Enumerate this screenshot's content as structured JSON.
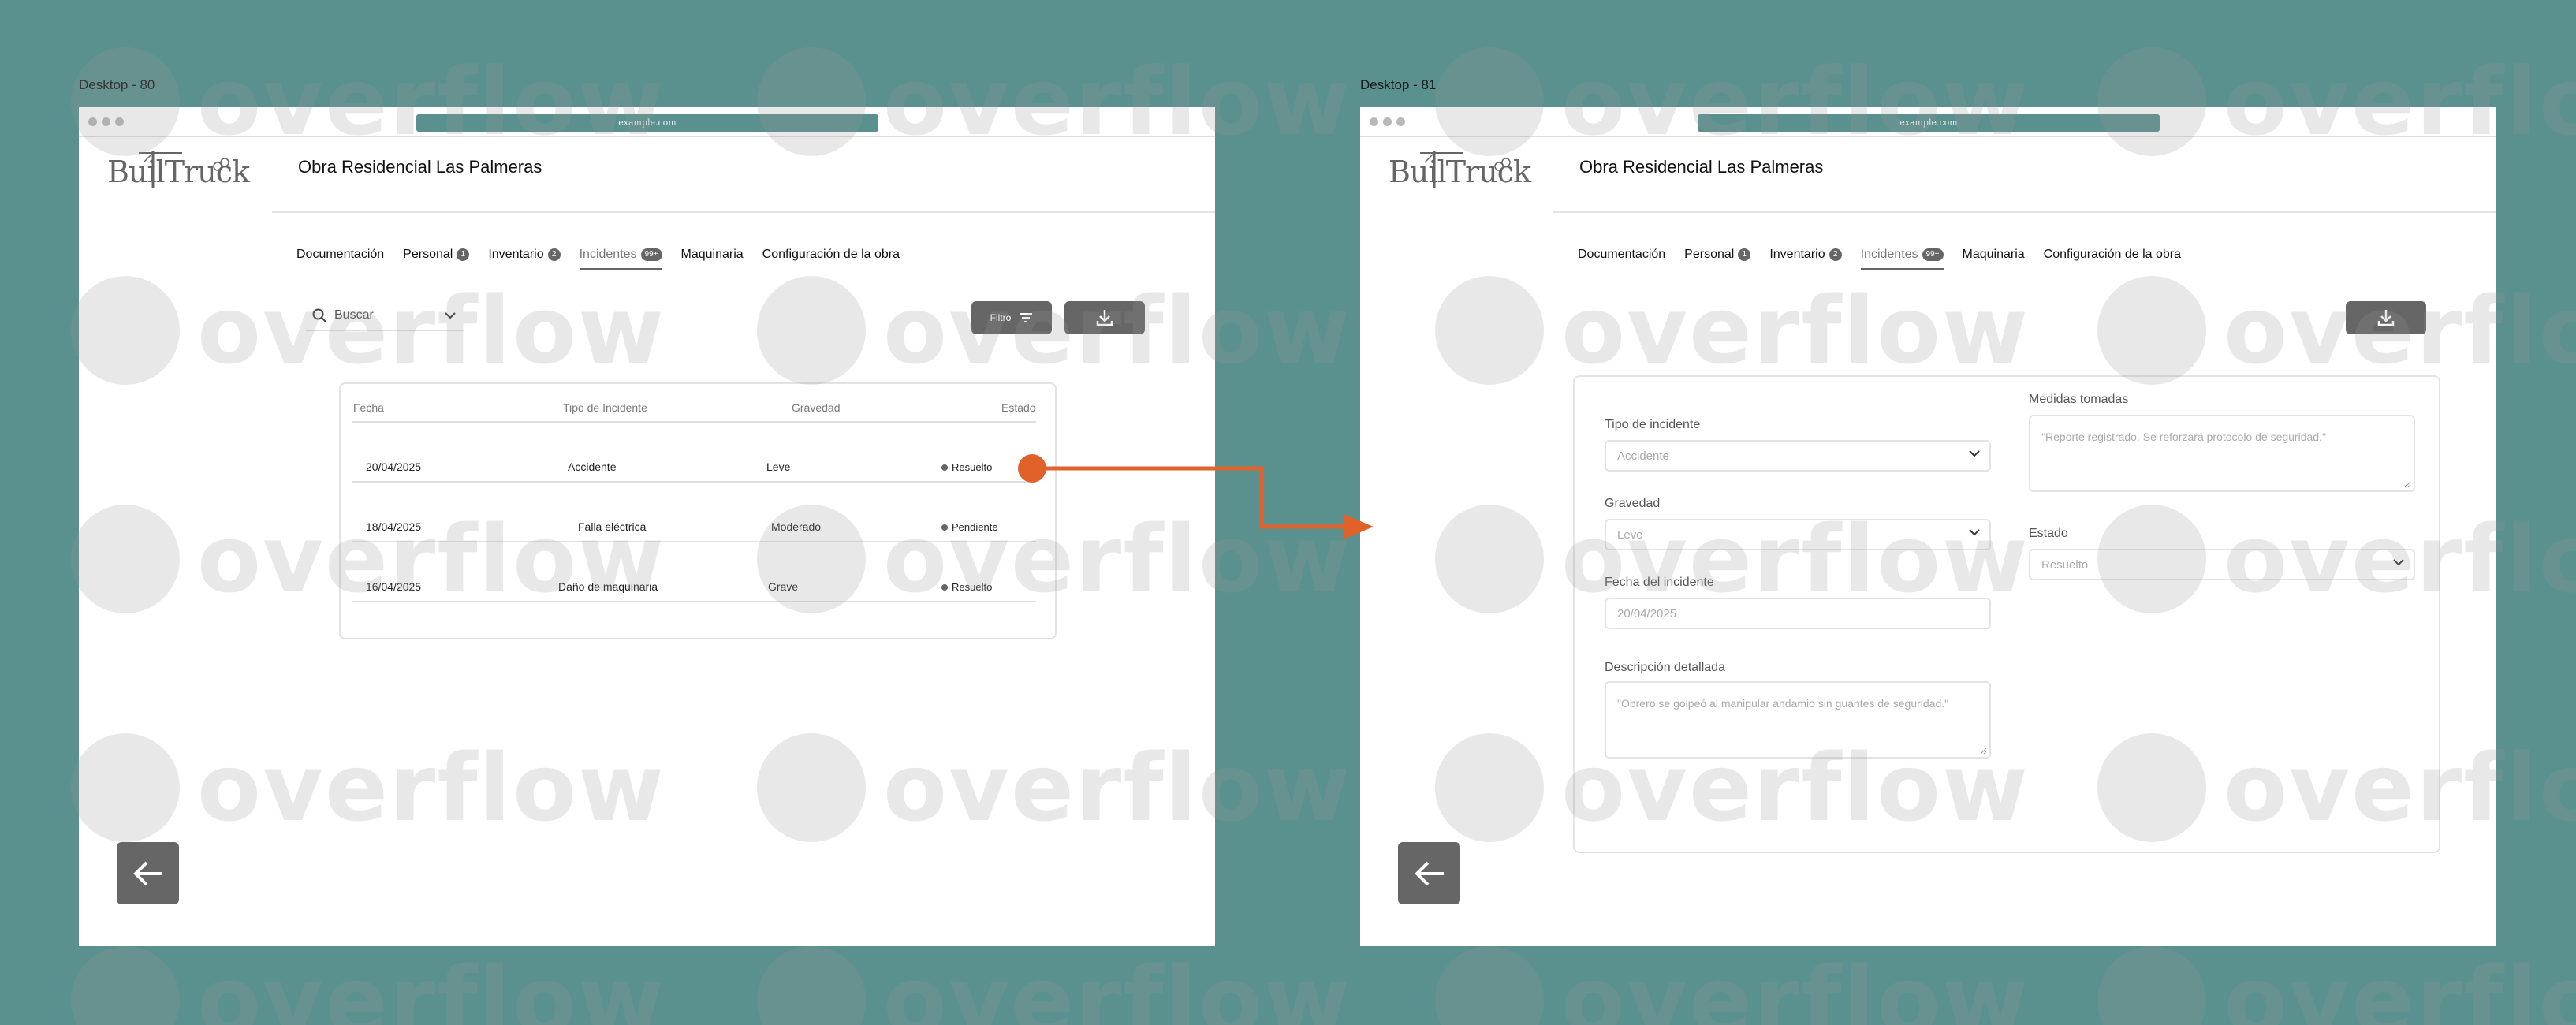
{
  "frames": {
    "left_label": "Desktop - 80",
    "right_label": "Desktop - 81"
  },
  "browser": {
    "url": "example.com"
  },
  "brand": {
    "logo_text": "BuilTruck"
  },
  "project": {
    "title": "Obra Residencial Las Palmeras"
  },
  "tabs": [
    {
      "label": "Documentación",
      "badge": ""
    },
    {
      "label": "Personal",
      "badge": "1"
    },
    {
      "label": "Inventario",
      "badge": "2"
    },
    {
      "label": "Incidentes",
      "badge": "99+"
    },
    {
      "label": "Maquinaria",
      "badge": ""
    },
    {
      "label": "Configuración de la obra",
      "badge": ""
    }
  ],
  "active_tab": "Incidentes",
  "search": {
    "placeholder": "Buscar"
  },
  "filter": {
    "label": "Filtro"
  },
  "table": {
    "columns": [
      "Fecha",
      "Tipo de Incidente",
      "Gravedad",
      "Estado"
    ],
    "rows": [
      {
        "fecha": "20/04/2025",
        "tipo": "Accidente",
        "gravedad": "Leve",
        "estado": "Resuelto"
      },
      {
        "fecha": "18/04/2025",
        "tipo": "Falla eléctrica",
        "gravedad": "Moderado",
        "estado": "Pendiente"
      },
      {
        "fecha": "16/04/2025",
        "tipo": "Daño de maquinaria",
        "gravedad": "Grave",
        "estado": "Resuelto"
      }
    ]
  },
  "form": {
    "tipo_label": "Tipo de incidente",
    "tipo_value": "Accidente",
    "gravedad_label": "Gravedad",
    "gravedad_value": "Leve",
    "fecha_label": "Fecha del incidente",
    "fecha_value": "20/04/2025",
    "descripcion_label": "Descripción detallada",
    "descripcion_value": "\"Obrero se golpeó al manipular andamio sin guantes de seguridad.\"",
    "medidas_label": "Medidas tomadas",
    "medidas_value": "\"Reporte registrado. Se reforzará protocolo de seguridad.\"",
    "estado_label": "Estado",
    "estado_value": "Resuelto"
  },
  "watermark": {
    "text": "overflow"
  },
  "colors": {
    "background": "#5a918f",
    "accent_arrow": "#e0622a",
    "button_dark": "#666666"
  }
}
